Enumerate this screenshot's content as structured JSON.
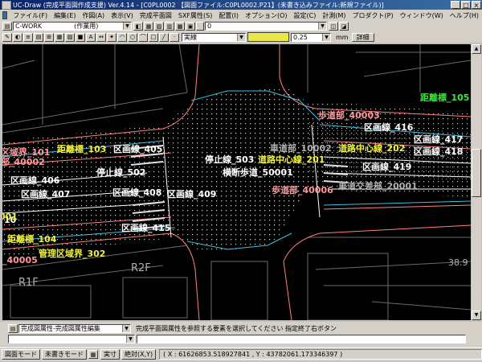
{
  "window": {
    "title": "UC-Draw (完成平面図作成支援) Ver.4.14 - [C0PL0002 【図面ファイル:C0PL0002.P21】(未書き込みファイル:新規ファイル)]"
  },
  "menu": [
    "ファイル(F)",
    "編集(E)",
    "作図(A)",
    "表示(V)",
    "完成平面図",
    "SXF属性(S)",
    "配置(I)",
    "オプション(O)",
    "設定(C)",
    "計測(M)",
    "プロダクト(P)",
    "ウィンドウ(W)",
    "ヘルプ(H)"
  ],
  "toolbar": {
    "layer_value": "C-WORK",
    "layer_type": "(作業用)",
    "layer_slot": "0",
    "line_type": "実線",
    "line_width": "0.25",
    "unit": "mm",
    "detail_label": "詳細",
    "line_color": "#e8e848"
  },
  "drawing": {
    "labels": [
      {
        "text": "歩道部_40003",
        "color": "pink"
      },
      {
        "text": "距離標_105",
        "color": "green"
      },
      {
        "text": "区画線_416",
        "color": "white"
      },
      {
        "text": "区画線_417",
        "color": "white"
      },
      {
        "text": "区画線_418",
        "color": "white"
      },
      {
        "text": "車道部_10002",
        "color": "gray"
      },
      {
        "text": "道路中心線_202",
        "color": "yellow"
      },
      {
        "text": "区画線_419",
        "color": "white"
      },
      {
        "text": "区域界_101",
        "color": "pink"
      },
      {
        "text": "距離標_103",
        "color": "yellow"
      },
      {
        "text": "区画線_405",
        "color": "white"
      },
      {
        "text": "停止線_503",
        "color": "white"
      },
      {
        "text": "道路中心線_201",
        "color": "yellow"
      },
      {
        "text": "横断歩道_50001",
        "color": "white"
      },
      {
        "text": "部_40002",
        "color": "pink"
      },
      {
        "text": "停止線_502",
        "color": "white"
      },
      {
        "text": "区画線_406",
        "color": "white"
      },
      {
        "text": "区画線_407",
        "color": "white"
      },
      {
        "text": "区画線_408",
        "color": "white"
      },
      {
        "text": "区画線_409",
        "color": "white"
      },
      {
        "text": "歩道部_40006",
        "color": "pink"
      },
      {
        "text": "車道交差部_20001",
        "color": "gray"
      },
      {
        "text": "区画線_415",
        "color": "white"
      },
      {
        "text": "10",
        "color": "white"
      },
      {
        "text": "001",
        "color": "yellow"
      },
      {
        "text": "距離標_104",
        "color": "yellow"
      },
      {
        "text": "_40005",
        "color": "pink"
      },
      {
        "text": "管理区域界_302",
        "color": "yellow"
      },
      {
        "text": "R2F",
        "color": "gray"
      },
      {
        "text": "R1F",
        "color": "gray"
      },
      {
        "text": "38.9",
        "color": "gray"
      }
    ]
  },
  "command": {
    "mode_value": "完成図属性-完成図属性編集",
    "prompt": "完成平面図属性を参照する要素を選択してください 指定終了右ボタン"
  },
  "status": {
    "mode_btn": "図面モード",
    "unwritten_btn": "未書きモード",
    "exec_btn": "実寸",
    "abs_btn": "絶対(X,Y)",
    "coords": "( X : 61626853.518927841 , Y : 43782061.173346397 )"
  }
}
